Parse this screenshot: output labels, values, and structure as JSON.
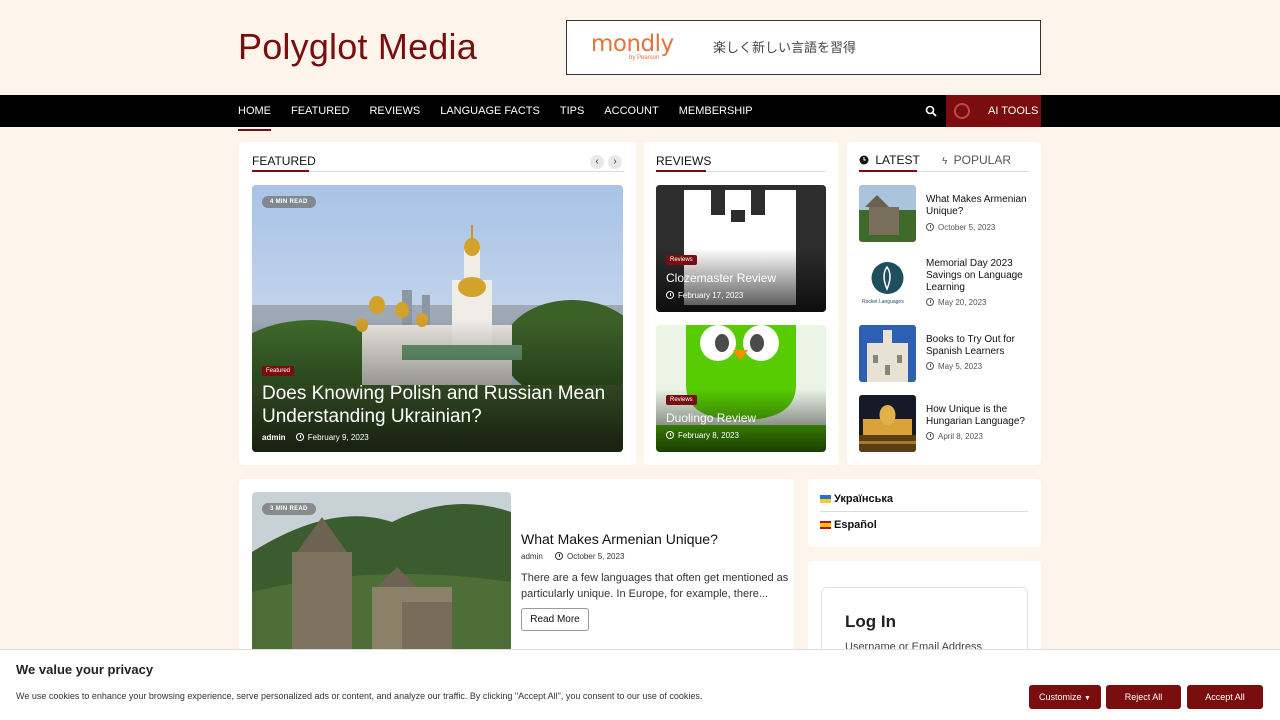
{
  "site": {
    "title": "Polyglot Media"
  },
  "ad": {
    "brand": "mondly",
    "brand_sub": "by Pearson",
    "text": "楽しく新しい言語を習得"
  },
  "nav": {
    "items": [
      "HOME",
      "FEATURED",
      "REVIEWS",
      "LANGUAGE FACTS",
      "TIPS",
      "ACCOUNT",
      "MEMBERSHIP"
    ],
    "ai_tools": "AI TOOLS"
  },
  "featured": {
    "heading": "FEATURED",
    "read_time": "4 MIN READ",
    "category": "Featured",
    "title_line1": "Does Knowing Polish and Russian Mean",
    "title_line2": "Understanding Ukrainian?",
    "author": "admin",
    "date": "February 9, 2023"
  },
  "reviews": {
    "heading": "REVIEWS",
    "items": [
      {
        "category": "Reviews",
        "title": "Clozemaster Review",
        "date": "February 17, 2023"
      },
      {
        "category": "Reviews",
        "title": "Duolingo Review",
        "date": "February 8, 2023"
      }
    ]
  },
  "sidebar_tabs": {
    "latest": "LATEST",
    "popular": "POPULAR"
  },
  "latest": [
    {
      "title_l1": "What Makes Armenian",
      "title_l2": "Unique?",
      "title_l3": "",
      "date": "October 5, 2023"
    },
    {
      "title_l1": "Memorial Day 2023",
      "title_l2": "Savings on Language",
      "title_l3": "Learning",
      "date": "May 20, 2023",
      "logo_text": "Rocket Languages"
    },
    {
      "title_l1": "Books to Try Out for",
      "title_l2": "Spanish Learners",
      "title_l3": "",
      "date": "May 5, 2023"
    },
    {
      "title_l1": "How Unique is the",
      "title_l2": "Hungarian Language?",
      "title_l3": "",
      "date": "April 8, 2023"
    }
  ],
  "article": {
    "read_time": "3 MIN READ",
    "title": "What Makes Armenian Unique?",
    "author": "admin",
    "date": "October 5, 2023",
    "excerpt_l1": "There are a few languages that often get mentioned as",
    "excerpt_l2": "particularly unique. In Europe, for example, there...",
    "read_more": "Read More"
  },
  "languages": [
    {
      "label": "Українська"
    },
    {
      "label": "Español"
    }
  ],
  "login": {
    "title": "Log In",
    "field_label": "Username or Email Address"
  },
  "cookie": {
    "title": "We value your privacy",
    "text": "We use cookies to enhance your browsing experience, serve personalized ads or content, and analyze our traffic. By clicking \"Accept All\", you consent to our use of cookies.",
    "customize": "Customize",
    "reject": "Reject All",
    "accept": "Accept All"
  },
  "colors": {
    "brand": "#7a0d0d",
    "nav_bg": "#000000",
    "page_bg": "#fdf5ec"
  }
}
